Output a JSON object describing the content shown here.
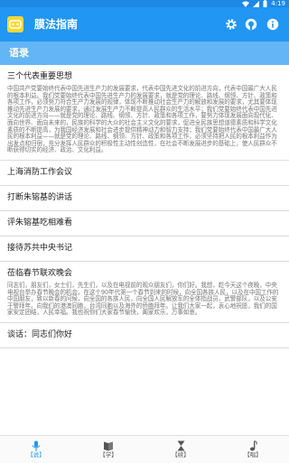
{
  "status_bar": {
    "time": "4:19"
  },
  "app_bar": {
    "title": "膜法指南"
  },
  "section": {
    "title": "语录"
  },
  "items": [
    {
      "title": "三个代表重要思想",
      "body": "中国共产党要始终代表中国先进生产力的发展要求，代表中国先进文化的前进方向，代表中国最广大人民的根本利益。我们党要始终代表中国先进生产力的发展要求，就是党的理论、路线、纲领、方针、政策和各项工作，必须努力符合生产力发展的规律，体现不断推动社会生产力的解放和发展的要求，尤其要体现推动先进生产力发展的要求，通过发展生产力不断提高人民群众的生活水平；我们党要始终代表中国先进文化的前进方向——就是党的理论、路线、纲领、方针、政策和各项工作，要努力体现发展面向现代化、面向世界、面向未来的，民族的科学的大众的社会主义文化的要求，促进全民族思想道德素质和科学文化素质的不断提高，为我国经济发展和社会进步提供精神动力和智力支持；我们党要始终代表中国最广大人民的根本利益——就是党的理论、路线、纲领、方针、政策和各项工作，必须坚持把人民的根本利益作为出发点和归宿，充分发挥人民群众的积极性主动性创造性，在社会不断发展进步的基础上，使人民群众不断获得切实的经济、政治、文化利益。"
    },
    {
      "title": "上海消防工作会议",
      "body": ""
    },
    {
      "title": "打断朱镕基的讲话",
      "body": ""
    },
    {
      "title": "评朱镕基吃相难看",
      "body": ""
    },
    {
      "title": "接待苏共中央书记",
      "body": ""
    },
    {
      "title": "莅临春节联欢晚会",
      "body": "同志们，朋友们，女士们，先生们，以及在电视前的观众朋友们，你们好。我想，趁今天这个夜晚，中央电视台举办春节晚会的机会，在这个90年代第一个春节到来的时候，向全国各族人民，以及在中国工作的中国朋友，致以新春的问候，向全国的各族人民，向全国人民解放军的全体指战员，武警部队，以及公安干警拜年。向我们的港澳同胞，台湾同胞以及海外的侨胞拜年。让我们大家一起，衷心地祝愿，我们的国家安定团结，人民幸福。我也祝你们大家春节愉快，阖家欢乐，万事如意。"
    },
    {
      "title": "谈话：同志们你好",
      "body": ""
    }
  ],
  "tabs": [
    {
      "label": "【说】",
      "icon": "microphone-icon"
    },
    {
      "label": "【学】",
      "icon": "book-icon"
    },
    {
      "label": "【续】",
      "icon": "hourglass-icon"
    },
    {
      "label": "【唱】",
      "icon": "music-note-icon"
    }
  ],
  "colors": {
    "status_bar": "#1e88e5",
    "app_bar": "#2196f3",
    "section_bar": "#64b5f6",
    "active_tab": "#2196f3"
  }
}
